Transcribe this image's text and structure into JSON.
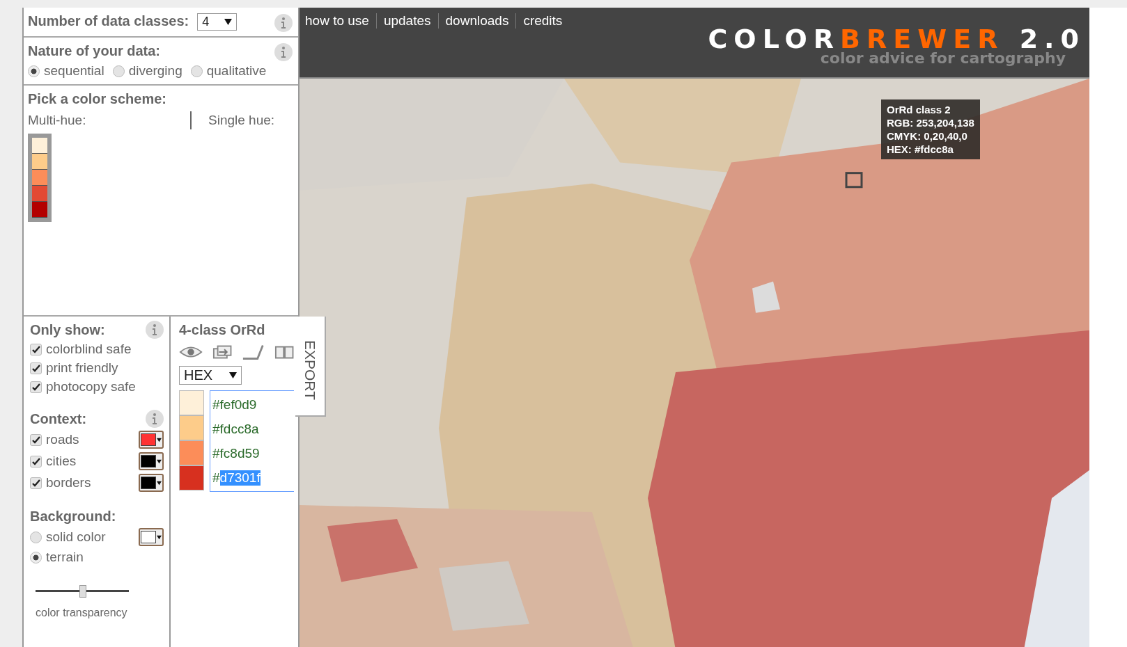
{
  "classes": {
    "label": "Number of data classes:",
    "value": "4"
  },
  "nature": {
    "label": "Nature of your data:",
    "options": [
      {
        "label": "sequential",
        "selected": true
      },
      {
        "label": "diverging",
        "selected": false
      },
      {
        "label": "qualitative",
        "selected": false
      }
    ]
  },
  "scheme": {
    "label": "Pick a color scheme:",
    "multi_hue": "Multi-hue:",
    "single_hue": "Single hue:",
    "swatches": [
      {
        "color": "#fef0d9"
      },
      {
        "color": "#fdcc8a"
      },
      {
        "color": "#fc8d59"
      },
      {
        "color": "#e34a33"
      },
      {
        "color": "#b30000"
      }
    ]
  },
  "only_show": {
    "label": "Only show:",
    "options": [
      {
        "label": "colorblind safe",
        "checked": true
      },
      {
        "label": "print friendly",
        "checked": true
      },
      {
        "label": "photocopy safe",
        "checked": true
      }
    ]
  },
  "context": {
    "label": "Context:",
    "layers": [
      {
        "label": "roads",
        "checked": true,
        "color": "#ff3333"
      },
      {
        "label": "cities",
        "checked": true,
        "color": "#000000"
      },
      {
        "label": "borders",
        "checked": true,
        "color": "#000000"
      }
    ]
  },
  "background": {
    "label": "Background:",
    "options": [
      {
        "label": "solid color",
        "selected": false,
        "color": "#ffffff"
      },
      {
        "label": "terrain",
        "selected": true
      }
    ]
  },
  "transparency": {
    "label": "color transparency",
    "level": 0.5
  },
  "legend": {
    "title": "4-class OrRd",
    "format": "HEX",
    "export": "EXPORT",
    "classes": [
      {
        "color": "#fef0d9",
        "code": "#fef0d9",
        "selected": false
      },
      {
        "color": "#fdcc8a",
        "code": "#fdcc8a",
        "selected": false
      },
      {
        "color": "#fc8d59",
        "code": "#fc8d59",
        "selected": false
      },
      {
        "color": "#d7301f",
        "code": "#d7301f",
        "selected": true
      }
    ]
  },
  "nav": [
    "how to use",
    "updates",
    "downloads",
    "credits"
  ],
  "logo": {
    "part1": "COLOR",
    "part2": "BREWER",
    "version": "2.0",
    "tagline": "color advice for cartography"
  },
  "tooltip": {
    "lines": [
      "OrRd class 2",
      "RGB: 253,204,138",
      "CMYK: 0,20,40,0",
      "HEX: #fdcc8a"
    ]
  }
}
